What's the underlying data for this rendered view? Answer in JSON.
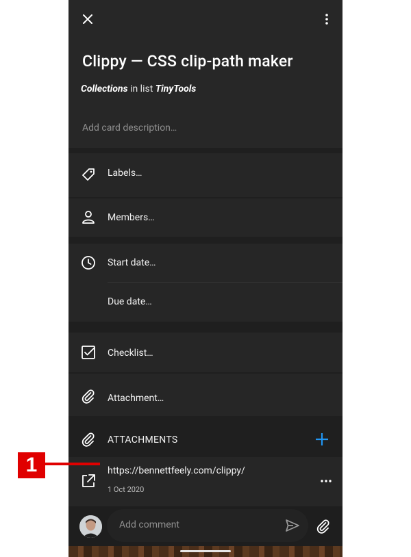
{
  "card": {
    "title": "Clippy — CSS clip-path maker",
    "collection": "Collections",
    "in_list_text": " in list ",
    "list_name": "TinyTools",
    "description_placeholder": "Add card description…"
  },
  "actions": {
    "labels": "Labels…",
    "members": "Members…",
    "start_date": "Start date…",
    "due_date": "Due date…",
    "checklist": "Checklist…",
    "attachment": "Attachment…"
  },
  "attachments": {
    "header": "ATTACHMENTS",
    "items": [
      {
        "url": "https://bennettfeely.com/clippy/",
        "date": "1 Oct 2020"
      }
    ]
  },
  "comment": {
    "placeholder": "Add comment"
  },
  "annotation": {
    "marker_label": "1",
    "color": "#e00000"
  },
  "colors": {
    "accent": "#2196f3",
    "background": "#1f1f1f",
    "surface": "#262626"
  }
}
